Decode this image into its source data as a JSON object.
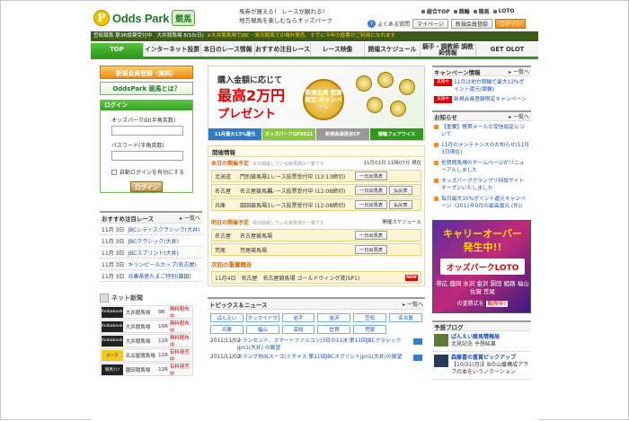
{
  "header": {
    "logo_mark": "P",
    "logo_text": "Odds Park",
    "logo_kanji": "競馬",
    "tagline_1": "馬券が買える！ レースが観れる！",
    "tagline_2": "地方競馬を楽しむならオッズパーク",
    "top_links": [
      "総合TOP",
      "競輪",
      "競馬",
      "LOTO"
    ],
    "help": "よくある質問",
    "mypage": "マイページ",
    "register": "新規会員登録",
    "login": "ログイン"
  },
  "ticker": {
    "text": "笠松競馬 第3R投票受付中",
    "text2": "大井競馬場 8/10(日)",
    "warn": "※大井競馬場でJBC・楽天競馬での場外発売、すでに今年の投票がご利用になれます"
  },
  "nav": [
    "TOP",
    "インターネット投票",
    "本日のレース情報",
    "おすすめ注目レース",
    "レース映像",
    "開催スケジュール",
    "騎手・調教師 調教師情報",
    "GET OLOT"
  ],
  "left": {
    "register_btn": "新規会員登録（無料）",
    "what_btn": "OddsPark 競馬とは？",
    "login_title": "ログイン",
    "id_label": "オッズパークID(半角英数)",
    "pw_label": "パスワード(半角英数)",
    "auto_login": "自動ログインを有効にする",
    "login_btn": "ログイン",
    "section_title": "おすすめ注目レース",
    "more": "一覧へ",
    "races": [
      {
        "date": "11月 3日",
        "title": "JBCレディスクラシック(大井)"
      },
      {
        "date": "11月 3日",
        "title": "JBCクラシック(大井)"
      },
      {
        "date": "11月 3日",
        "title": "JBCスプリント(大井)"
      },
      {
        "date": "11月 3日",
        "title": "キリンビールカップ(名古屋)"
      },
      {
        "date": "11月 3日",
        "title": "兵庫県産たまご特別(園田)"
      }
    ],
    "net_title": "ネット新聞",
    "papers": [
      {
        "venue": "大井競馬場",
        "race": "9R",
        "status": "無料配布中"
      },
      {
        "venue": "大井競馬場",
        "race": "10R",
        "status": "無料配布中"
      },
      {
        "venue": "大井競馬場",
        "race": "11R",
        "status": "無料配布中"
      },
      {
        "venue": "名古屋競馬場",
        "race": "11R",
        "status": "有料発売中"
      },
      {
        "venue": "園田競馬場",
        "race": "12R",
        "status": "有料発売中"
      }
    ]
  },
  "center": {
    "banner": {
      "line1": "購入金額に応じて",
      "line2": "最高2万円",
      "line3": "プレゼント",
      "seal": "新規会員 登録限定 キャンペーン",
      "tabs": [
        "11月最大13%還元",
        "オッズパークGP2011",
        "新規会員限定CP",
        "競輪フェアワイス"
      ]
    },
    "info_title": "開催情報",
    "today_hd": "本日の開催予定",
    "today_note": "本日開催している競馬場の一覧です",
    "today_time": "11月03日 11時07分 現在",
    "today": [
      {
        "pref": "北海道",
        "track": "門別競馬場",
        "status": "1レース投票受付中 (13:13締切)",
        "btns": [
          "一日出馬表"
        ]
      },
      {
        "pref": "名古屋",
        "track": "名古屋競馬場",
        "status": "3レース投票受付中 (12:08締切)",
        "btns": [
          "一日出馬表",
          "払戻表"
        ]
      },
      {
        "pref": "兵庫",
        "track": "園田競馬場",
        "status": "3レース投票受付中 (12:08締切)",
        "btns": [
          "一日出馬表",
          "払戻表"
        ]
      }
    ],
    "tomorrow_hd": "明日の開催予定",
    "tomorrow_note": "明日開催している競馬場の一覧です",
    "schedule_link": "開催スケジュール",
    "tomorrow": [
      {
        "pref": "名古屋",
        "track": "名古屋競馬場",
        "btns": [
          "一日出馬表"
        ]
      },
      {
        "pref": "荒尾",
        "track": "荒尾競馬場",
        "btns": [
          "一日出馬表"
        ]
      }
    ],
    "grade_hd": "次回の重賞競走",
    "grade": {
      "date": "11月4日",
      "pref": "名古屋",
      "race": "名古屋競馬場 ゴールドウィング賞(SP1)",
      "badge": "NEW"
    },
    "topics_title": "トピックス＆ニュース",
    "more": "一覧へ",
    "categories": [
      "ばんえい",
      "ホッカイドウ",
      "岩手",
      "金沢",
      "笠松",
      "名古屋",
      "兵庫",
      "福山",
      "高知",
      "佐賀",
      "荒尾"
    ],
    "news": [
      {
        "date": "2011/11/02",
        "text": "トランセンド、スマートファルコン(3日の11決 第11回JBCクラシックJpn1(大井) の展望"
      },
      {
        "date": "2011/11/02",
        "text": "スラング他出スーゴ(ミチャス 第11回JBCスプリントJpn1(大井)の展望"
      }
    ]
  },
  "right": {
    "campaign_title": "キャンペーン情報",
    "more": "一覧へ",
    "campaigns": [
      {
        "tag": "実施中",
        "text": "11月は地方競輪で最大13%ポイント還元(競輪)"
      },
      {
        "tag": "実施中",
        "text": "新規会員登録限定キャンペーン"
      }
    ],
    "notice_title": "お知らせ",
    "notices": [
      "【重要】携帯メールの受信設定について",
      "11月のメンテナンスのお知らせ(11月3日現在)",
      "佐賀競馬場のホームページがリニューアルしました",
      "オッズパークグランプリ特設サイトオープンいたしました",
      "毎日最大10%ポイント還元キャンペーン（2011年9月の最高還元 (件)）"
    ],
    "carry_1": "キャリーオーバー",
    "carry_2": "発生中!!",
    "carry_3": "オッズパークLOTO",
    "carry_4": "帯広 盛岡 水沢 金沢 園田 姫路 福山 佐賀 荒尾",
    "carry_5": "の重勝式を",
    "carry_6": "販売中!",
    "blog_title": "予想ブログ",
    "blogs": [
      {
        "title": "ばんえい競馬情報局",
        "sub": "北見記念 予想結果"
      },
      {
        "title": "森藤喜の重賞ピックアップ",
        "sub": "【10/31(月)】Bの山番構成アラブの血をいうノクーション"
      }
    ]
  }
}
